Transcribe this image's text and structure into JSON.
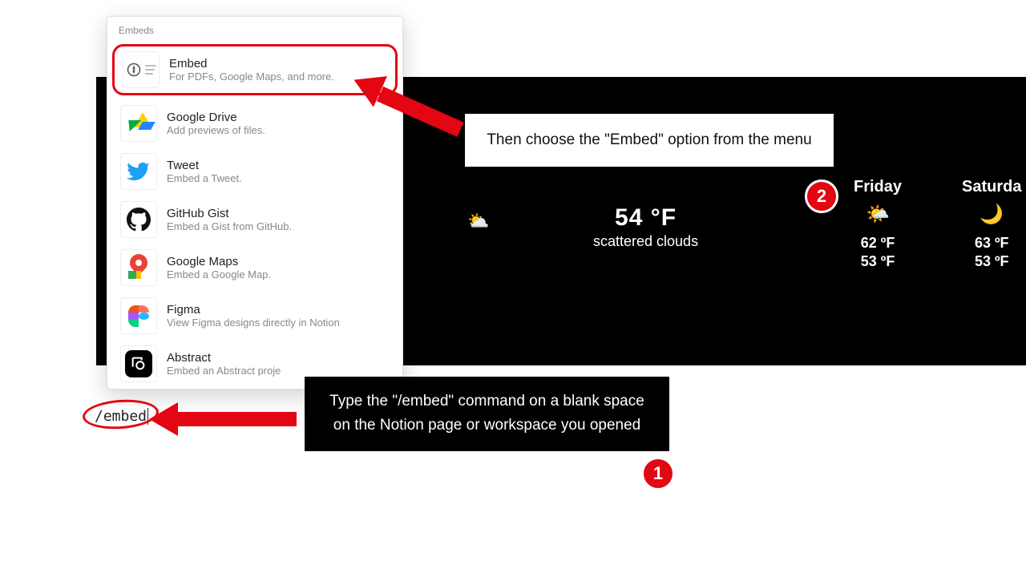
{
  "menu": {
    "header": "Embeds",
    "items": [
      {
        "title": "Embed",
        "sub": "For PDFs, Google Maps, and more."
      },
      {
        "title": "Google Drive",
        "sub": "Add previews of files."
      },
      {
        "title": "Tweet",
        "sub": "Embed a Tweet."
      },
      {
        "title": "GitHub Gist",
        "sub": "Embed a Gist from GitHub."
      },
      {
        "title": "Google Maps",
        "sub": "Embed a Google Map."
      },
      {
        "title": "Figma",
        "sub": "View Figma designs directly in Notion"
      },
      {
        "title": "Abstract",
        "sub": "Embed an Abstract proje"
      }
    ]
  },
  "command": "/embed",
  "callouts": {
    "step1": "Type the \"/embed\" command on a blank space on the Notion page or workspace you opened",
    "step2": "Then choose the \"Embed\" option from the menu",
    "badge1": "1",
    "badge2": "2"
  },
  "weather": {
    "temp": "54 °F",
    "cond": "scattered clouds",
    "forecast": [
      {
        "day": "Friday",
        "hi": "62 ºF",
        "lo": "53 ºF"
      },
      {
        "day": "Saturda",
        "hi": "63 ºF",
        "lo": "53 ºF"
      }
    ]
  }
}
